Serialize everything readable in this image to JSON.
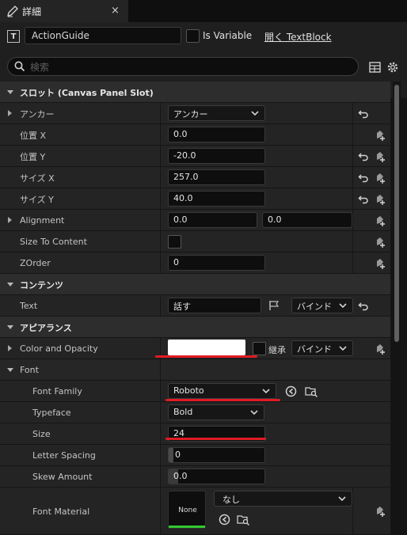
{
  "tab": {
    "title": "詳細",
    "close": "×"
  },
  "header": {
    "type_badge": "T",
    "widget_name": "ActionGuide",
    "is_variable_label": "Is Variable",
    "open_link": "開く TextBlock",
    "search_placeholder": "検索"
  },
  "categories": {
    "slot": "スロット (Canvas Panel Slot)",
    "content": "コンテンツ",
    "appearance": "アピアランス",
    "font": "Font"
  },
  "props": {
    "anchor": {
      "label": "アンカー",
      "value": "アンカー"
    },
    "position_x": {
      "label": "位置 X",
      "value": "0.0"
    },
    "position_y": {
      "label": "位置 Y",
      "value": "-20.0"
    },
    "size_x": {
      "label": "サイズ X",
      "value": "257.0"
    },
    "size_y": {
      "label": "サイズ Y",
      "value": "40.0"
    },
    "alignment": {
      "label": "Alignment",
      "x": "0.0",
      "y": "0.0"
    },
    "size_to_content": {
      "label": "Size To Content"
    },
    "zorder": {
      "label": "ZOrder",
      "value": "0"
    },
    "text": {
      "label": "Text",
      "value": "話す",
      "bind": "バインド"
    },
    "color_opacity": {
      "label": "Color and Opacity",
      "inherit": "継承",
      "bind": "バインド",
      "color": "#ffffff"
    },
    "font_family": {
      "label": "Font Family",
      "value": "Roboto"
    },
    "typeface": {
      "label": "Typeface",
      "value": "Bold"
    },
    "size": {
      "label": "Size",
      "value": "24"
    },
    "letter_spacing": {
      "label": "Letter Spacing",
      "value": "0"
    },
    "skew_amount": {
      "label": "Skew Amount",
      "value": "0.0",
      "fill_fraction": 0.1
    },
    "font_material": {
      "label": "Font Material",
      "thumb": "None",
      "value": "なし"
    }
  },
  "colors": {
    "accent_red": "#e01b24",
    "thumb_green": "#32c832"
  }
}
